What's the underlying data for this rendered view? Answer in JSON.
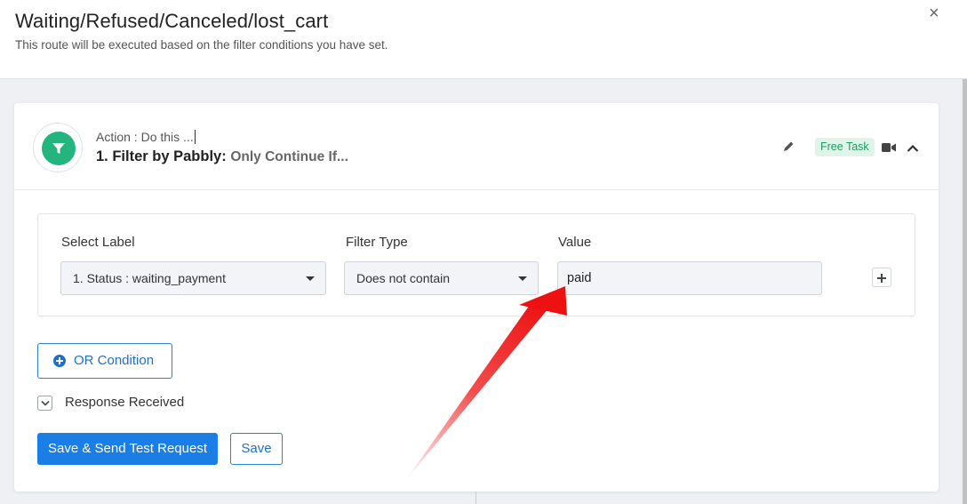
{
  "header": {
    "title": "Waiting/Refused/Canceled/lost_cart",
    "subtitle": "This route will be executed based on the filter conditions you have set.",
    "close_label": "×"
  },
  "step": {
    "kicker": "Action : Do this ...",
    "title": "1. Filter by Pabbly:",
    "subtitle": "Only Continue If...",
    "badge": "Free Task",
    "app_icon": "filter-icon",
    "accent": "#24b47e"
  },
  "filter": {
    "columns": [
      "Select Label",
      "Filter Type",
      "Value"
    ],
    "label_value": "1. Status : waiting_payment",
    "type_value": "Does not contain",
    "value_value": "paid"
  },
  "actions": {
    "or_condition": "OR Condition",
    "response_label": "Response Received",
    "save_send": "Save & Send Test Request",
    "save": "Save"
  },
  "colors": {
    "primary": "#1a7ee6",
    "badge_bg": "#dff5e9",
    "badge_text": "#1f9d5d",
    "annotation_arrow": "#ee1111"
  }
}
